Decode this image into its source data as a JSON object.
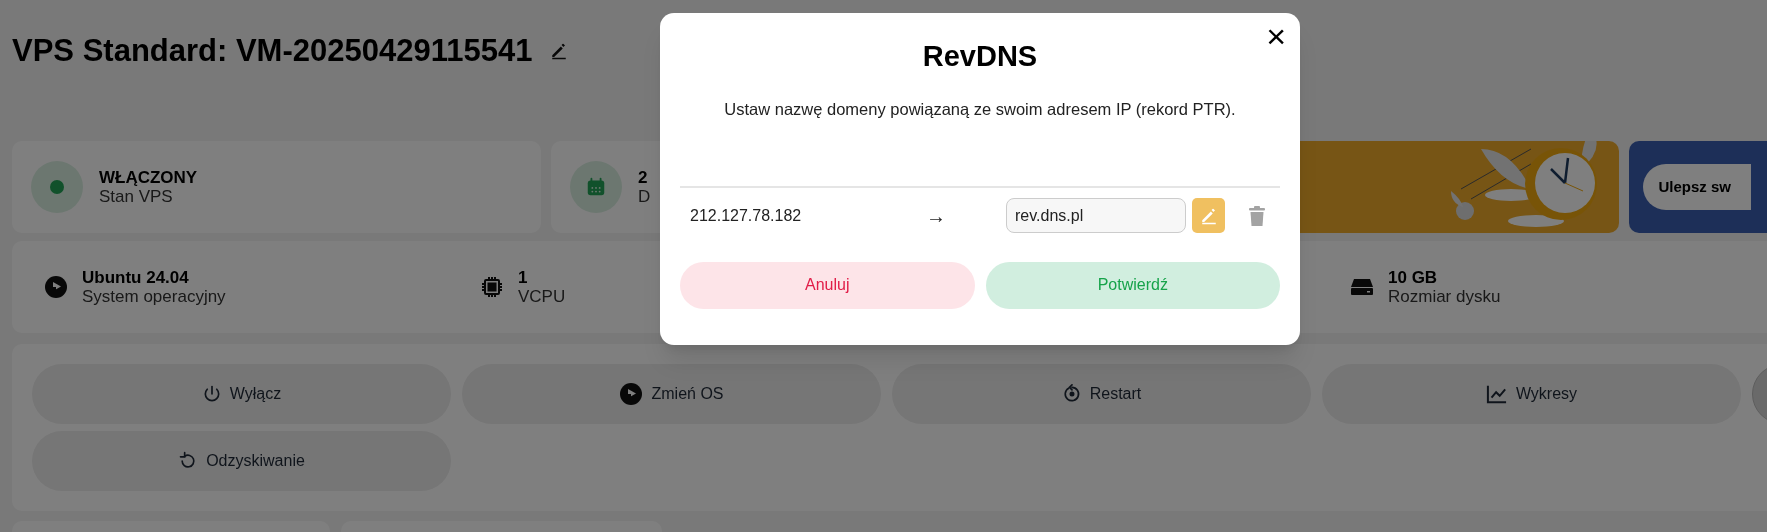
{
  "page": {
    "title": "VPS Standard: VM-20250429115541"
  },
  "status_cards": [
    {
      "kind": "status",
      "value": "WŁĄCZONY",
      "label": "Stan VPS"
    },
    {
      "kind": "date",
      "value": "2",
      "label": "D"
    }
  ],
  "upgrade": {
    "button": "Ulepsz sw"
  },
  "specs": [
    {
      "kind": "os",
      "value": "Ubuntu 24.04",
      "label": "System operacyjny"
    },
    {
      "kind": "cpu",
      "value": "1",
      "label": "VCPU"
    },
    {
      "kind": "disk",
      "value": "10 GB",
      "label": "Rozmiar dysku"
    }
  ],
  "actions": [
    {
      "kind": "power",
      "label": "Wyłącz"
    },
    {
      "kind": "os",
      "label": "Zmień OS"
    },
    {
      "kind": "restart",
      "label": "Restart"
    },
    {
      "kind": "charts",
      "label": "Wykresy"
    },
    {
      "kind": "more"
    },
    {
      "kind": "recovery",
      "label": "Odzyskiwanie"
    }
  ],
  "dialog": {
    "title": "RevDNS",
    "close": "×",
    "description": "Ustaw nazwę domeny powiązaną ze swoim adresem IP (rekord PTR).",
    "rows": [
      {
        "ip": "212.127.78.182",
        "arrow": "→",
        "domain": "rev.dns.pl"
      }
    ],
    "buttons": [
      {
        "kind": "cancel",
        "label": "Anuluj"
      },
      {
        "kind": "confirm",
        "label": "Potwierdź"
      }
    ]
  }
}
